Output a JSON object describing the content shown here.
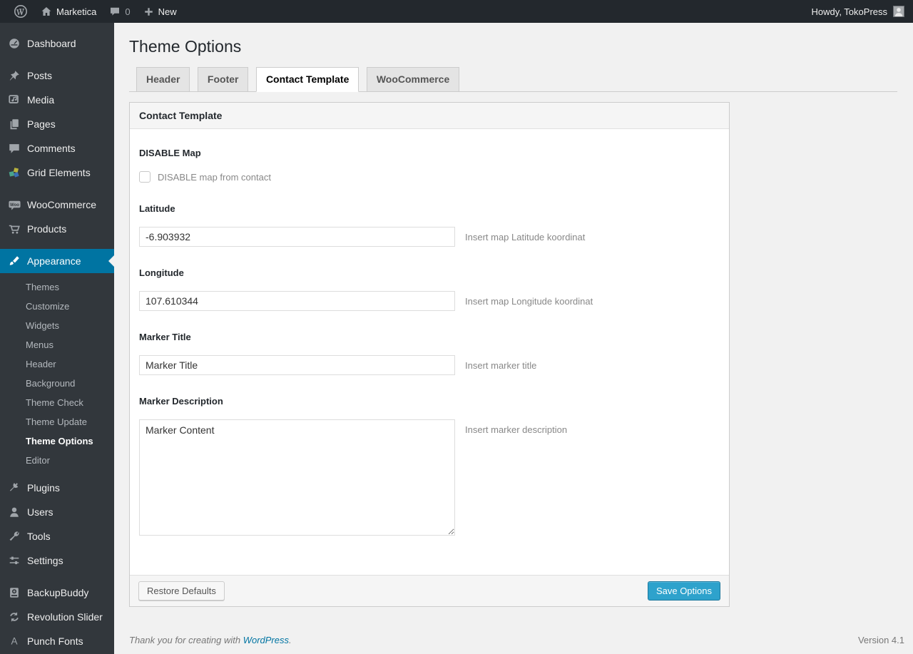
{
  "admin_bar": {
    "site_name": "Marketica",
    "comment_count": "0",
    "new_label": "New",
    "howdy": "Howdy, TokoPress"
  },
  "sidebar": {
    "items": [
      {
        "label": "Dashboard"
      },
      {
        "label": "Posts"
      },
      {
        "label": "Media"
      },
      {
        "label": "Pages"
      },
      {
        "label": "Comments"
      },
      {
        "label": "Grid Elements"
      },
      {
        "label": "WooCommerce"
      },
      {
        "label": "Products"
      },
      {
        "label": "Appearance",
        "active": true
      },
      {
        "label": "Plugins"
      },
      {
        "label": "Users"
      },
      {
        "label": "Tools"
      },
      {
        "label": "Settings"
      },
      {
        "label": "BackupBuddy"
      },
      {
        "label": "Revolution Slider"
      },
      {
        "label": "Punch Fonts"
      }
    ],
    "appearance_submenu": [
      {
        "label": "Themes"
      },
      {
        "label": "Customize"
      },
      {
        "label": "Widgets"
      },
      {
        "label": "Menus"
      },
      {
        "label": "Header"
      },
      {
        "label": "Background"
      },
      {
        "label": "Theme Check"
      },
      {
        "label": "Theme Update"
      },
      {
        "label": "Theme Options",
        "active": true
      },
      {
        "label": "Editor"
      }
    ]
  },
  "page": {
    "title": "Theme Options",
    "tabs": [
      {
        "label": "Header",
        "active": false
      },
      {
        "label": "Footer",
        "active": false
      },
      {
        "label": "Contact Template",
        "active": true
      },
      {
        "label": "WooCommerce",
        "active": false
      }
    ],
    "panel_title": "Contact Template",
    "fields": [
      {
        "label": "DISABLE Map",
        "type": "checkbox",
        "checkbox_label": "DISABLE map from contact",
        "checked": false
      },
      {
        "label": "Latitude",
        "type": "text",
        "value": "-6.903932",
        "hint": "Insert map Latitude koordinat"
      },
      {
        "label": "Longitude",
        "type": "text",
        "value": "107.610344",
        "hint": "Insert map Longitude koordinat"
      },
      {
        "label": "Marker Title",
        "type": "text",
        "value": "Marker Title",
        "hint": "Insert marker title"
      },
      {
        "label": "Marker Description",
        "type": "textarea",
        "value": "Marker Content",
        "hint": "Insert marker description"
      }
    ],
    "buttons": {
      "restore": "Restore Defaults",
      "save": "Save Options"
    }
  },
  "footer": {
    "thanks_text": "Thank you for creating with",
    "link_label": "WordPress",
    "suffix": ".",
    "version": "Version 4.1"
  },
  "colors": {
    "admin_bar_bg": "#23282d",
    "menu_bg": "#32373c",
    "highlight": "#0074a2",
    "primary_button": "#2ea2cc",
    "link": "#0074a2"
  }
}
